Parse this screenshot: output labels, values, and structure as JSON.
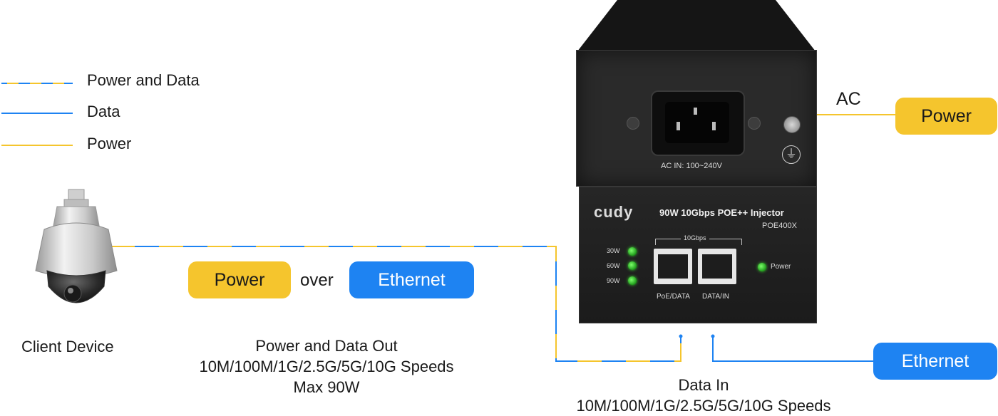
{
  "legend": {
    "items": [
      {
        "label": "Power and Data",
        "style": "blue-yellow-dashed"
      },
      {
        "label": "Data",
        "style": "blue"
      },
      {
        "label": "Power",
        "style": "yellow"
      }
    ]
  },
  "client": {
    "label": "Client Device"
  },
  "poe_badge": {
    "power": "Power",
    "over": "over",
    "ethernet": "Ethernet"
  },
  "output_text": {
    "line1": "Power and Data Out",
    "line2": "10M/100M/1G/2.5G/5G/10G Speeds",
    "line3": "Max 90W"
  },
  "input_text": {
    "line1": "Data In",
    "line2": "10M/100M/1G/2.5G/5G/10G Speeds"
  },
  "ac": {
    "label": "AC",
    "power_pill": "Power"
  },
  "ethernet_pill": "Ethernet",
  "device": {
    "ac_in": "AC IN: 100~240V",
    "brand": "cudy",
    "product_name": "90W 10Gbps POE++ Injector",
    "model": "POE400X",
    "speed_label": "10Gbps",
    "leds": [
      "30W",
      "60W",
      "90W"
    ],
    "power_led": "Power",
    "port1": "PoE/DATA",
    "port2": "DATA/IN"
  },
  "colors": {
    "power_yellow": "#F5C52D",
    "data_blue": "#1E83F2",
    "led_green": "#39d52e"
  }
}
